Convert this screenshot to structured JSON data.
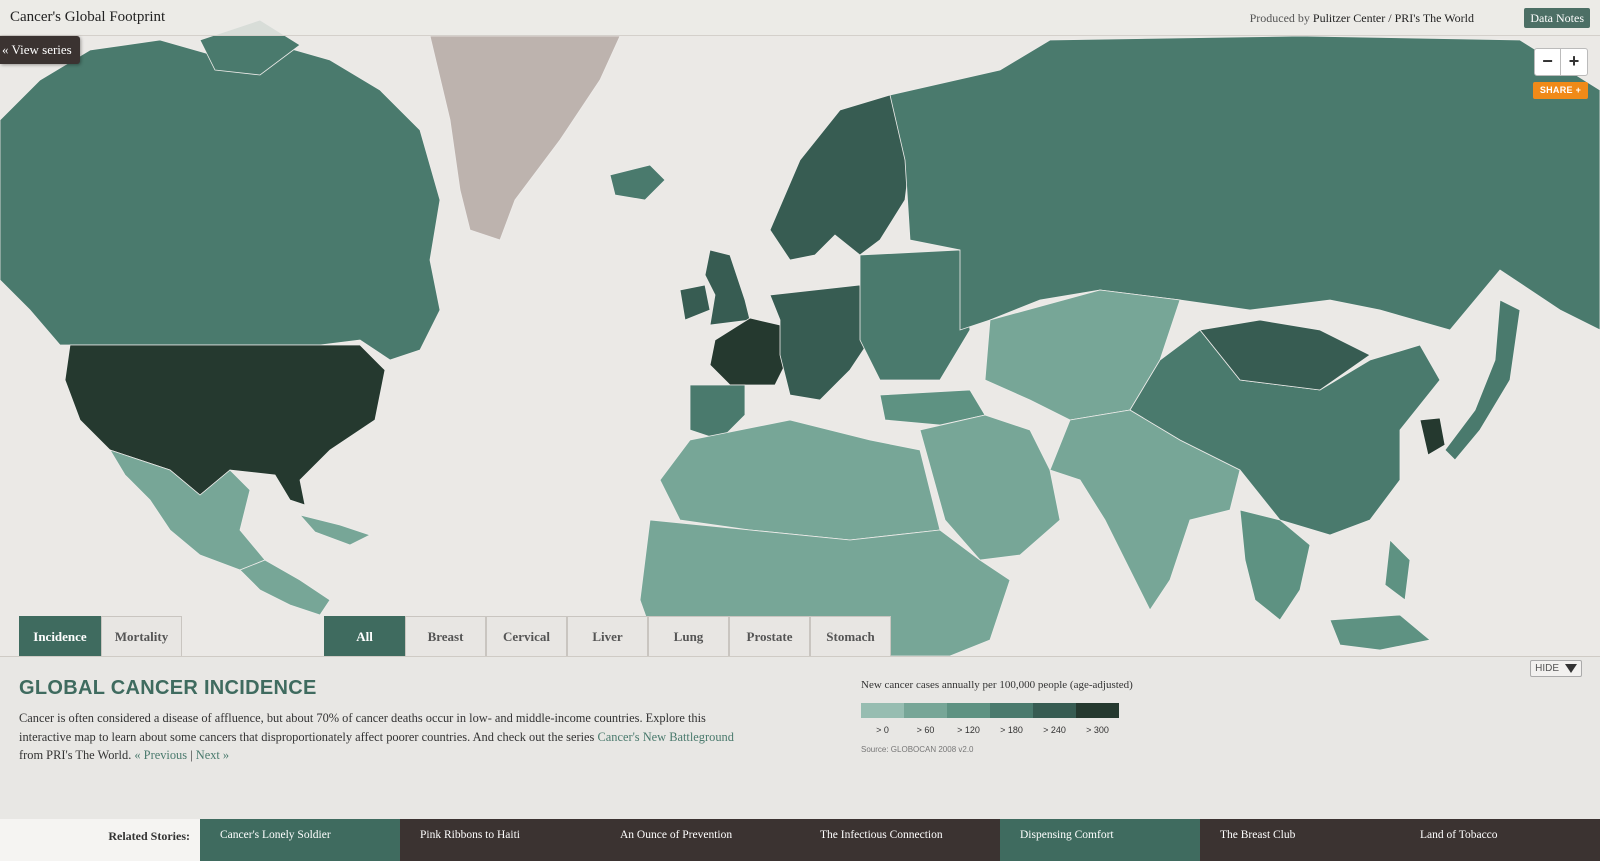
{
  "header": {
    "title": "Cancer's Global Footprint",
    "produced_by_prefix": "Produced by",
    "produced_by": "Pulitzer Center / PRI's The World",
    "data_notes": "Data Notes"
  },
  "view_series": "« View series",
  "zoom": {
    "minus": "−",
    "plus": "+"
  },
  "share": "SHARE +",
  "tabs_measure": [
    {
      "label": "Incidence",
      "active": true
    },
    {
      "label": "Mortality",
      "active": false
    }
  ],
  "tabs_cancer": [
    {
      "label": "All",
      "active": true
    },
    {
      "label": "Breast",
      "active": false
    },
    {
      "label": "Cervical",
      "active": false
    },
    {
      "label": "Liver",
      "active": false
    },
    {
      "label": "Lung",
      "active": false
    },
    {
      "label": "Prostate",
      "active": false
    },
    {
      "label": "Stomach",
      "active": false
    }
  ],
  "panel": {
    "title": "GLOBAL CANCER INCIDENCE",
    "desc_1": "Cancer is often considered a disease of affluence, but about 70% of cancer deaths occur in low- and middle-income countries. Explore this interactive map to learn about some cancers that disproportionately affect poorer countries. And check out the series ",
    "desc_link": "Cancer's New Battleground",
    "desc_2": " from PRI's The World. ",
    "prev": "« Previous",
    "sep": " | ",
    "next": "Next »",
    "hide": "HIDE"
  },
  "legend": {
    "title": "New cancer cases annually per 100,000 people (age-adjusted)",
    "bins": [
      {
        "label": "> 0",
        "color": "#97bdb1"
      },
      {
        "label": "> 60",
        "color": "#77a697"
      },
      {
        "label": "> 120",
        "color": "#5e9282"
      },
      {
        "label": "> 180",
        "color": "#4a7a6d"
      },
      {
        "label": "> 240",
        "color": "#375c52"
      },
      {
        "label": "> 300",
        "color": "#25392f"
      }
    ],
    "source": "Source: GLOBOCAN 2008 v2.0"
  },
  "related": {
    "label": "Related Stories:",
    "stories": [
      "Cancer's Lonely Soldier",
      "Pink Ribbons to Haiti",
      "An Ounce of Prevention",
      "The Infectious Connection",
      "Dispensing Comfort",
      "The Breast Club",
      "Land of Tobacco"
    ]
  },
  "regions": [
    {
      "name": "Canada",
      "bin": 3
    },
    {
      "name": "United States",
      "bin": 5
    },
    {
      "name": "Mexico",
      "bin": 1
    },
    {
      "name": "Central America & Caribbean",
      "bin": 1
    },
    {
      "name": "Greenland",
      "bin": -1
    },
    {
      "name": "Iceland",
      "bin": 3
    },
    {
      "name": "Scandinavia",
      "bin": 4
    },
    {
      "name": "United Kingdom",
      "bin": 4
    },
    {
      "name": "Ireland",
      "bin": 4
    },
    {
      "name": "France",
      "bin": 5
    },
    {
      "name": "Iberia",
      "bin": 3
    },
    {
      "name": "Central Europe",
      "bin": 4
    },
    {
      "name": "Eastern Europe",
      "bin": 3
    },
    {
      "name": "Russia",
      "bin": 3
    },
    {
      "name": "Turkey",
      "bin": 2
    },
    {
      "name": "North Africa",
      "bin": 1
    },
    {
      "name": "Sub-Saharan Africa",
      "bin": 1
    },
    {
      "name": "Middle East",
      "bin": 1
    },
    {
      "name": "Central Asia",
      "bin": 1
    },
    {
      "name": "South Asia",
      "bin": 1
    },
    {
      "name": "China",
      "bin": 3
    },
    {
      "name": "Mongolia",
      "bin": 4
    },
    {
      "name": "Korea",
      "bin": 5
    },
    {
      "name": "Japan",
      "bin": 3
    },
    {
      "name": "Southeast Asia",
      "bin": 2
    }
  ]
}
